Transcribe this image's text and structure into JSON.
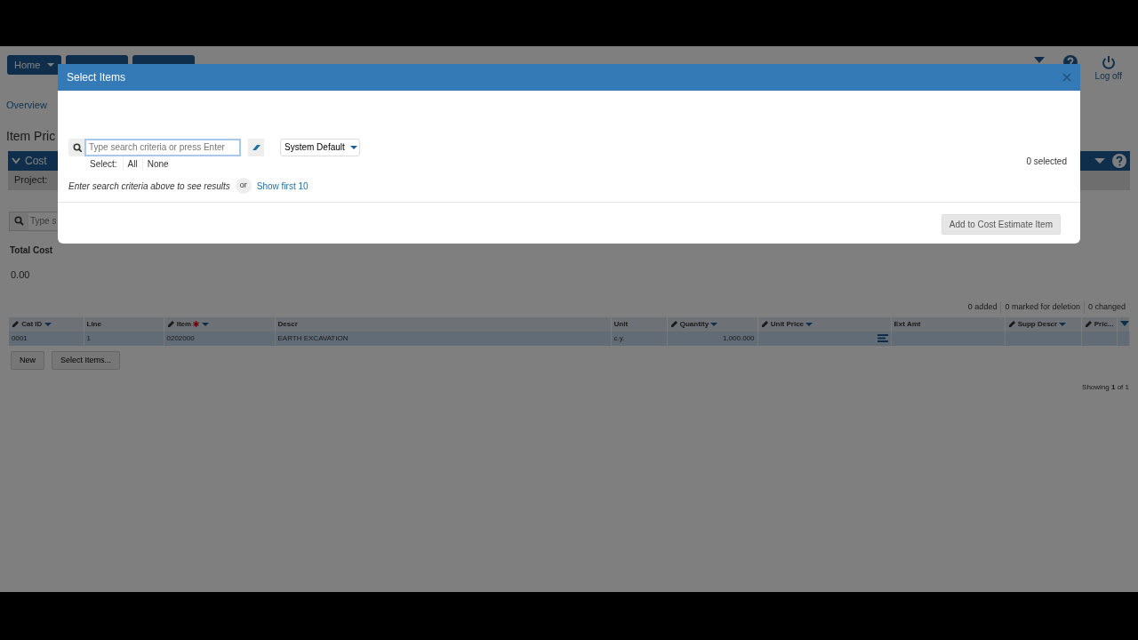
{
  "app": {
    "nav_buttons": [
      {
        "label": "Home"
      }
    ],
    "logoff": "Log off",
    "tabs": [
      {
        "label": "Overview"
      }
    ],
    "page_title": "Item Pric",
    "section": "Cost",
    "project_label": "Project:",
    "search_placeholder": "Type s",
    "total_label": "Total Cost",
    "total_value": "0.00",
    "counts": [
      "0 added",
      "0 marked for deletion",
      "0 changed"
    ],
    "table": {
      "columns": [
        {
          "label": "Cat ID",
          "editable": true,
          "sortable": true,
          "required": false
        },
        {
          "label": "Line",
          "editable": false,
          "sortable": false,
          "required": false
        },
        {
          "label": "Item",
          "editable": true,
          "sortable": true,
          "required": true
        },
        {
          "label": "Descr",
          "editable": false,
          "sortable": false,
          "required": false
        },
        {
          "label": "Unit",
          "editable": false,
          "sortable": false,
          "required": false
        },
        {
          "label": "Quantity",
          "editable": true,
          "sortable": true,
          "required": false
        },
        {
          "label": "Unit Price",
          "editable": true,
          "sortable": true,
          "required": false
        },
        {
          "label": "Ext Amt",
          "editable": false,
          "sortable": false,
          "required": false
        },
        {
          "label": "Supp Descr",
          "editable": true,
          "sortable": true,
          "required": false
        },
        {
          "label": "Pric...",
          "editable": true,
          "sortable": false,
          "required": false
        }
      ],
      "rows": [
        {
          "selected": true,
          "cells": [
            "0001",
            "1",
            "0202000",
            "EARTH EXCAVATION",
            "c.y.",
            "1,000.000",
            "",
            "",
            "",
            ""
          ]
        }
      ]
    },
    "buttons": [
      "New",
      "Select Items..."
    ],
    "footer": "Showing **1** of 1"
  },
  "modal": {
    "title": "Select Items",
    "search": {
      "placeholder": "Type search criteria or press Enter"
    },
    "view_select": "System Default",
    "select_label": "Select:",
    "select_links": [
      "All",
      "None"
    ],
    "selected_count": "0 selected",
    "hint": "Enter search criteria above to see results",
    "or": "or",
    "show_first": "Show first 10",
    "action_button": "Add to Cost Estimate Item"
  }
}
